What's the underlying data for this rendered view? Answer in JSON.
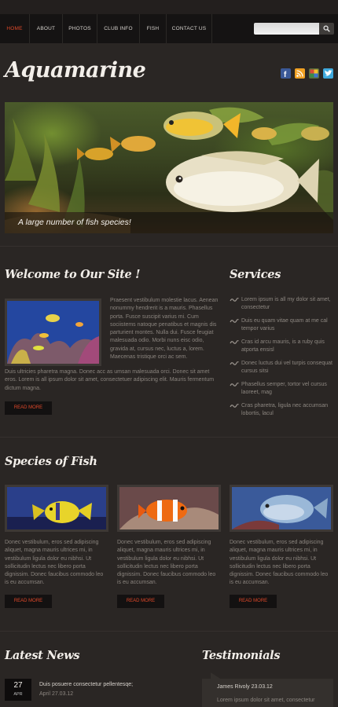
{
  "nav": {
    "items": [
      "HOME",
      "ABOUT",
      "PHOTOS",
      "CLUB INFO",
      "FISH",
      "CONTACT US"
    ],
    "active": "HOME",
    "search_placeholder": ""
  },
  "logo": "Aquamarine",
  "social": [
    "facebook-icon",
    "rss-icon",
    "google-plus-icon",
    "twitter-icon"
  ],
  "hero": {
    "caption": "A large number of fish species!"
  },
  "welcome": {
    "title": "Welcome to Our Site !",
    "side_text": "Praesent vestibulum molestie lacus. Aenean nonummy hendrerit is a mauris. Phasellus porta. Fusce suscipit varius mi. Cum sociistems natoque penatibus et magnis dis parturient montes. Nulla dui. Fusce feugiat malesuada odio. Morbi nuns eisc odio, gravida at, cursus nec, luctus a, lorem. Maecenas tristique orci ac sem.",
    "bottom_text": "Duis ultricies pharetra magna. Donec acc as umsan malesuada orci. Donec sit amet eros. Lorem is all ipsum dolor sit amet, consectetuer adipiscing elit. Mauris fermentum dictum magna.",
    "button": "READ MORE"
  },
  "services": {
    "title": "Services",
    "items": [
      "Lorem ipsum is all my dolor sit amet, consectetur",
      "Duis eu quam vitae quam at me cal tempor varius",
      "Cras id arcu mauris, is a ruby quis atporta ensisl",
      "Donec luctus dui vel turpis consequat cursus sitsi",
      "Phasellus semper, tortor vel cursus laoreet, mag",
      "Cras pharetra, ligula nec accumsan lobortis, lacul"
    ]
  },
  "species": {
    "title": "Species of Fish",
    "items": [
      {
        "text": "Donec vestibulum, eros sed adipiscing aliquet, magna mauris ultrices mi, in vestibulum ligula dolor eu nibhsi. Ut sollicitudin lectus nec libero porta dignissim. Donec faucibus commodo leo is eu accumsan.",
        "button": "READ MORE"
      },
      {
        "text": "Donec vestibulum, eros sed adipiscing aliquet, magna mauris ultrices mi, in vestibulum ligula dolor eu nibhsi. Ut sollicitudin lectus nec libero porta dignissim. Donec faucibus commodo leo is eu accumsan.",
        "button": "READ MORE"
      },
      {
        "text": "Donec vestibulum, eros sed adipiscing aliquet, magna mauris ultrices mi, in vestibulum ligula dolor eu nibhsi. Ut sollicitudin lectus nec libero porta dignissim. Donec faucibus commodo leo is eu accumsan.",
        "button": "READ MORE"
      }
    ]
  },
  "news": {
    "title": "Latest News",
    "day": "27",
    "month": "APR",
    "headline": "Duis posuere consectetur pellentesqe;",
    "date": "April 27.03.12"
  },
  "testimonials": {
    "title": "Testimonials",
    "author": "James Rivoly 23.03.12",
    "text": "Lorem ipsum dolor sit amet, consectetur"
  },
  "colors": {
    "accent": "#e0492a",
    "background": "#2a2624",
    "nav": "#151313"
  }
}
